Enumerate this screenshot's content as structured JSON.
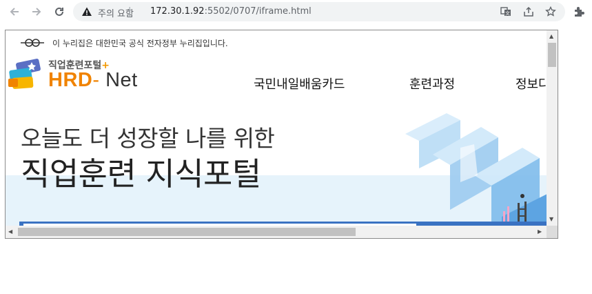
{
  "browser": {
    "security_label": "주의 요함",
    "separator": "|",
    "url_host": "172.30.1.92",
    "url_path": ":5502/0707/iframe.html",
    "icons": [
      "back-icon",
      "forward-icon",
      "reload-icon",
      "warning-icon",
      "translate-icon",
      "share-icon",
      "bookmark-star-icon",
      "extensions-icon"
    ]
  },
  "page": {
    "gov_notice": "이 누리집은 대한민국 공식 전자정부 누리집입니다.",
    "logo": {
      "subtitle": "직업훈련포털",
      "plus": "+",
      "hrd": "HRD",
      "dash": "-",
      "net": "Net"
    },
    "menu": [
      {
        "label": "국민내일배움카드"
      },
      {
        "label": "훈련과정"
      },
      {
        "label": "정보다"
      }
    ],
    "hero": {
      "subtitle": "오늘도 더 성장할 나를 위한",
      "title": "직업훈련 지식포털"
    }
  },
  "colors": {
    "accent_orange": "#f08300",
    "hero_blue": "#3a72c2",
    "hero_bg": "#e6f3fb"
  }
}
